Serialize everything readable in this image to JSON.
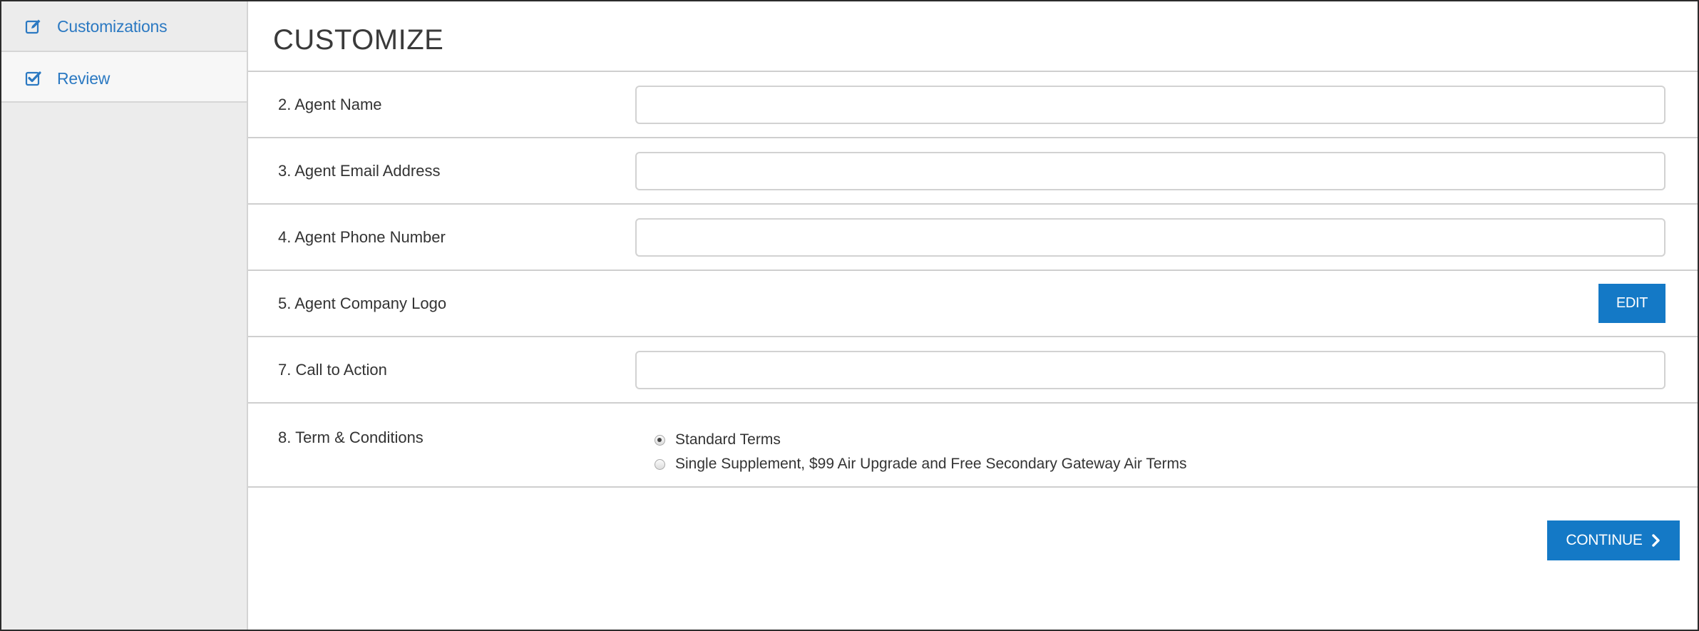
{
  "sidebar": {
    "items": [
      {
        "label": "Customizations",
        "icon": "edit-icon"
      },
      {
        "label": "Review",
        "icon": "checkbox-checked-icon"
      }
    ]
  },
  "header": {
    "title": "CUSTOMIZE"
  },
  "form": {
    "agent_name": {
      "label": "2.  Agent Name",
      "value": "",
      "placeholder": ""
    },
    "agent_email": {
      "label": "3.  Agent Email Address",
      "value": "",
      "placeholder": ""
    },
    "agent_phone": {
      "label": "4.  Agent Phone Number",
      "value": "",
      "placeholder": ""
    },
    "agent_logo": {
      "label": "5. Agent Company Logo",
      "button_label": "EDIT"
    },
    "call_to_action": {
      "label": "7.  Call to Action",
      "value": "",
      "placeholder": ""
    },
    "terms": {
      "label": "8. Term & Conditions",
      "options": [
        {
          "label": "Standard Terms",
          "selected": true
        },
        {
          "label": "Single Supplement, $99 Air Upgrade and Free Secondary Gateway Air Terms",
          "selected": false
        }
      ]
    }
  },
  "actions": {
    "continue_label": "CONTINUE"
  },
  "colors": {
    "accent": "#1479c6",
    "link": "#2b79c2",
    "sidebar_bg": "#ececec"
  }
}
